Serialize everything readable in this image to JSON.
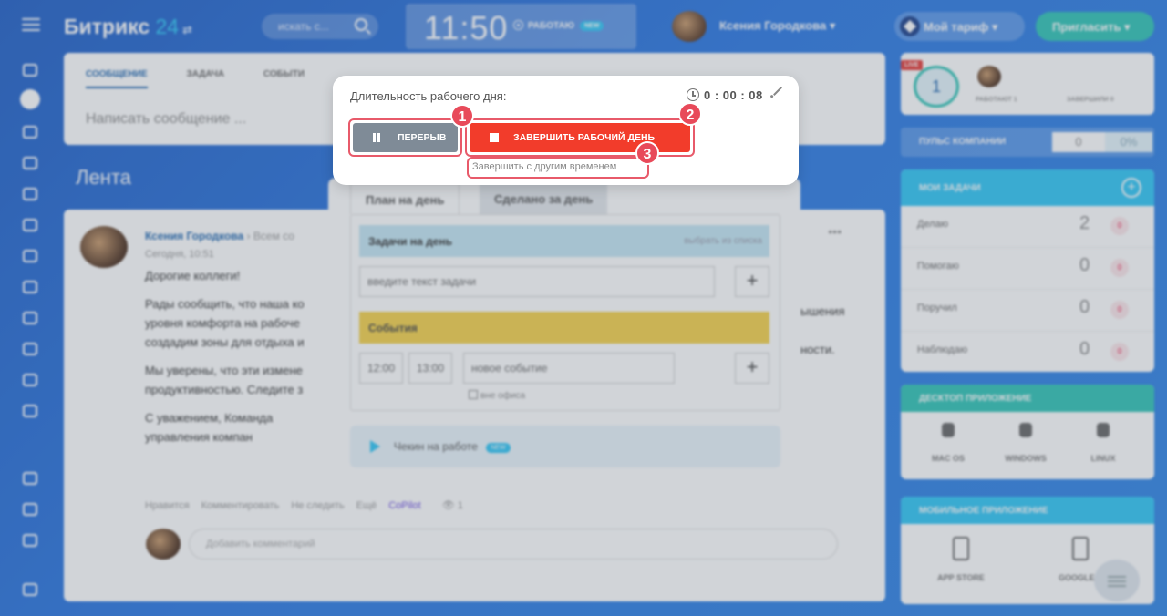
{
  "topbar": {
    "logo": "Битрикс",
    "logo_num": "24",
    "search_placeholder": "искать с...",
    "clock": "11:50",
    "status": "РАБОТАЮ",
    "status_badge": "NEW",
    "user_name": "Ксения Городкова",
    "tariff": "Мой тариф",
    "invite": "Пригласить"
  },
  "composer": {
    "tabs": [
      "СООБЩЕНИЕ",
      "ЗАДАЧА",
      "СОБЫТИ"
    ],
    "placeholder": "Написать сообщение ..."
  },
  "feed": {
    "title": "Лента"
  },
  "post": {
    "author": "Ксения Городкова",
    "recipient": "Всем со",
    "date": "Сегодня, 10:51",
    "paragraphs": [
      "Дорогие коллеги!",
      "Рады сообщить, что наша ко уровня комфорта на рабоче создадим зоны для отдыха и",
      "Мы уверены, что эти измене продуктивностью. Следите з",
      "С уважением, Команда управления компан"
    ],
    "right_fragment_1": "ышения",
    "right_fragment_2": "ности.",
    "actions": [
      "Нравится",
      "Комментировать",
      "Не следить",
      "Ещё"
    ],
    "copilot": "CoPilot",
    "views": "1",
    "comment_placeholder": "Добавить комментарий"
  },
  "timeman": {
    "tab_plan": "План на день",
    "tab_done": "Сделано за день",
    "tasks_header": "Задачи на день",
    "tasks_link": "выбрать из списка",
    "task_placeholder": "введите текст задачи",
    "events_header": "События",
    "event_from": "12:00",
    "event_to": "13:00",
    "event_placeholder": "новое событие",
    "outside_office": "вне офиса",
    "checkin": "Чекин на работе",
    "checkin_badge": "NEW"
  },
  "popup": {
    "title": "Длительность рабочего дня:",
    "timer": "0 : 00 : 08",
    "break_button": "ПЕРЕРЫВ",
    "end_button": "ЗАВЕРШИТЬ РАБОЧИЙ ДЕНЬ",
    "end_other_time": "Завершить с другим временем",
    "markers": [
      "1",
      "2",
      "3"
    ],
    "highlight_color": "#e85a6a",
    "end_color": "#f23c2b"
  },
  "right": {
    "live": "LIVE",
    "live_count": "1",
    "working_label": "РАБОТАЮТ 1",
    "finished_label": "ЗАВЕРШИЛИ 0",
    "pulse_label": "ПУЛЬС КОМПАНИИ",
    "pulse_value": "0",
    "pulse_percent": "0%",
    "tasks_title": "МОИ ЗАДАЧИ",
    "tasks": [
      {
        "label": "Делаю",
        "count": "2",
        "badge": "0"
      },
      {
        "label": "Помогаю",
        "count": "0",
        "badge": "0"
      },
      {
        "label": "Поручил",
        "count": "0",
        "badge": "0"
      },
      {
        "label": "Наблюдаю",
        "count": "0",
        "badge": "0"
      }
    ],
    "desktop_title": "ДЕСКТОП ПРИЛОЖЕНИЕ",
    "desktop_os": [
      "MAC OS",
      "WINDOWS",
      "LINUX"
    ],
    "mobile_title": "МОБИЛЬНОЕ ПРИЛОЖЕНИЕ",
    "mobile_stores": [
      "APP STORE",
      "GOOGLE P"
    ]
  }
}
